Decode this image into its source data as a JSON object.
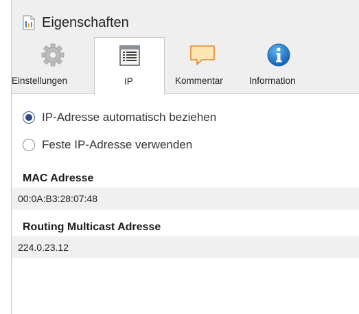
{
  "window": {
    "title": "Eigenschaften",
    "title_icon": "properties-document-icon"
  },
  "tabs": [
    {
      "label": "Einstellungen",
      "icon": "gear-icon",
      "active": false
    },
    {
      "label": "IP",
      "icon": "ip-list-icon",
      "active": true
    },
    {
      "label": "Kommentar",
      "icon": "comment-icon",
      "active": false
    },
    {
      "label": "Information",
      "icon": "info-icon",
      "active": false
    }
  ],
  "ip_settings": {
    "options": [
      {
        "label": "IP-Adresse automatisch beziehen",
        "selected": true
      },
      {
        "label": "Feste IP-Adresse verwenden",
        "selected": false
      }
    ]
  },
  "fields": {
    "mac": {
      "label": "MAC Adresse",
      "value": "00:0A:B3:28:07:48"
    },
    "multicast": {
      "label": "Routing Multicast Adresse",
      "value": "224.0.23.12"
    }
  },
  "colors": {
    "header_bg": "#efefef",
    "field_bg": "#f0f0f0",
    "accent_blue": "#2d4a88",
    "comment_icon_fill": "#fde6b3",
    "comment_icon_stroke": "#e08a2c",
    "info_icon_blue": "#1a78c8"
  }
}
